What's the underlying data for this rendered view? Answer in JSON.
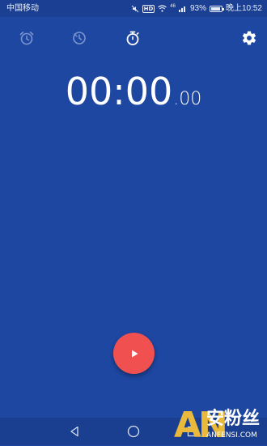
{
  "status_bar": {
    "carrier": "中国移动",
    "hd": "HD",
    "signal_label": "46",
    "battery_percent": "93%",
    "battery_level": 0.93,
    "time": "晚上10:52"
  },
  "tabs": [
    {
      "name": "alarm",
      "icon": "alarm-clock-icon",
      "active": false
    },
    {
      "name": "world-clock",
      "icon": "world-clock-icon",
      "active": false
    },
    {
      "name": "stopwatch",
      "icon": "stopwatch-icon",
      "active": true
    }
  ],
  "settings": {
    "icon": "gear-icon"
  },
  "stopwatch": {
    "main": "00:00",
    "fraction": ".00"
  },
  "controls": {
    "start_icon": "play-icon",
    "accent_color": "#f05050"
  },
  "colors": {
    "background": "#1e47a2",
    "status_bar": "#1a3f93",
    "inactive_icon": "#7d95cf"
  },
  "nav_bar": {
    "back_icon": "back-triangle-icon",
    "home_icon": "home-circle-icon",
    "recent_icon": "recent-square-icon"
  },
  "watermark": {
    "letters": "AN",
    "chinese": "安粉丝",
    "domain": "ANFENSI.COM"
  }
}
